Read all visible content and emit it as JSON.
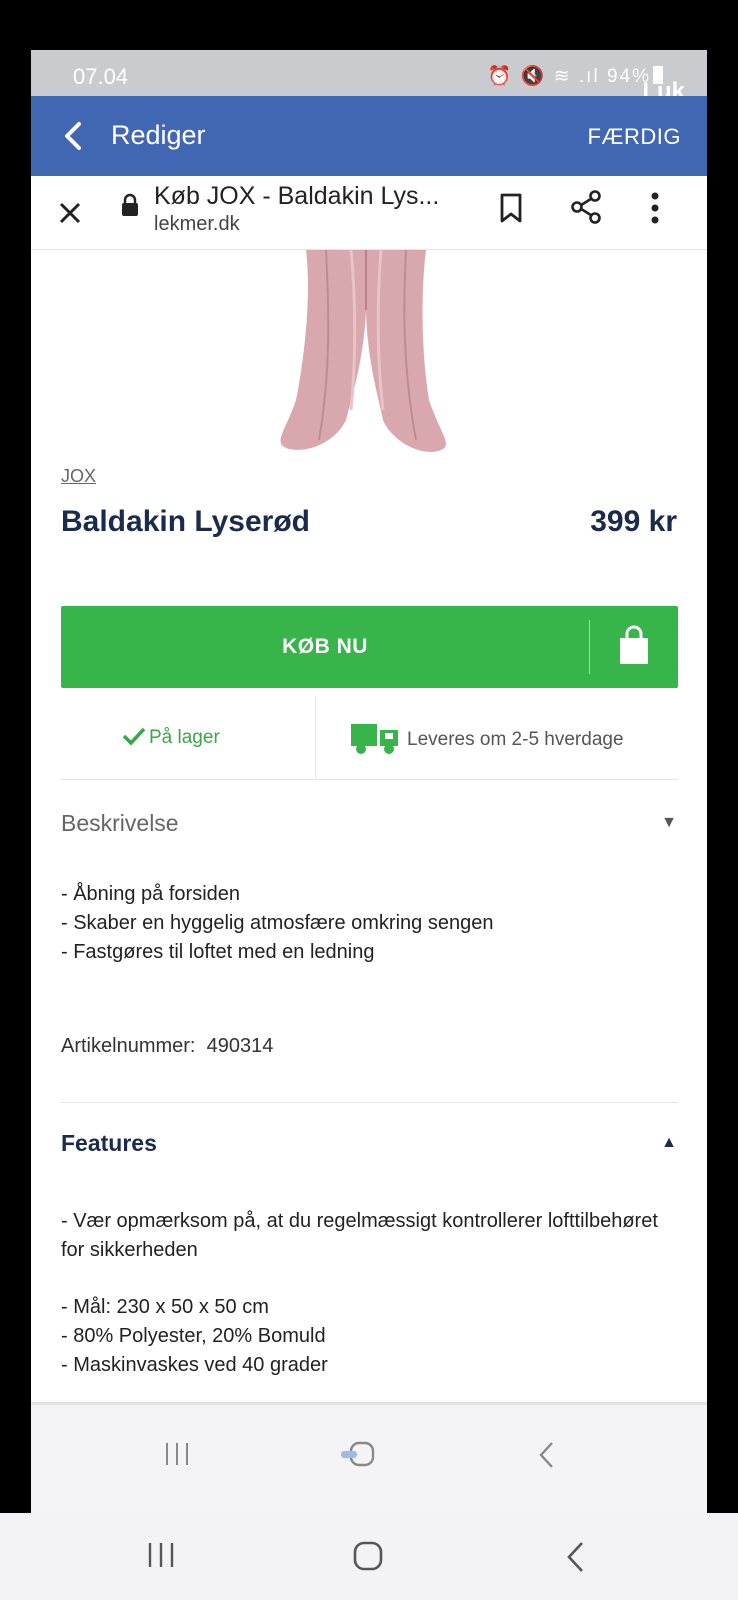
{
  "status": {
    "time": "07.04",
    "battery": "94%",
    "overlay": "Luk"
  },
  "edit_header": {
    "title": "Rediger",
    "done": "FÆRDIG"
  },
  "browser": {
    "page_title": "Køb JOX - Baldakin Lys...",
    "domain": "lekmer.dk"
  },
  "product": {
    "brand": "JOX",
    "name": "Baldakin Lyserød",
    "price": "399 kr"
  },
  "buy_button": {
    "label": "KØB NU"
  },
  "stock": {
    "label": "På lager"
  },
  "delivery": {
    "label": "Leveres om 2-5 hverdage"
  },
  "description": {
    "heading": "Beskrivelse",
    "lines": [
      "- Åbning på forsiden",
      "- Skaber en hyggelig atmosfære omkring sengen",
      "- Fastgøres til loftet med en ledning"
    ],
    "article": "Artikelnummer:  490314"
  },
  "features": {
    "heading": "Features",
    "text": "- Vær opmærksom på, at du regelmæssigt kontrollerer lofttilbehøret for sikkerheden",
    "lines": [
      "- Mål: 230 x 50 x 50 cm",
      "- 80% Polyester, 20% Bomuld",
      "- Maskinvaskes ved 40 grader"
    ]
  },
  "colors": {
    "facebook_blue": "#4267b2",
    "buy_green": "#37b44a",
    "navy": "#1a2b4d"
  },
  "icons": [
    "back-arrow-icon",
    "close-icon",
    "lock-icon",
    "bookmark-icon",
    "share-icon",
    "more-icon",
    "shopping-bag-icon",
    "check-icon",
    "truck-icon",
    "caret-down-icon",
    "caret-up-icon",
    "recents-icon",
    "home-icon",
    "back-icon"
  ]
}
